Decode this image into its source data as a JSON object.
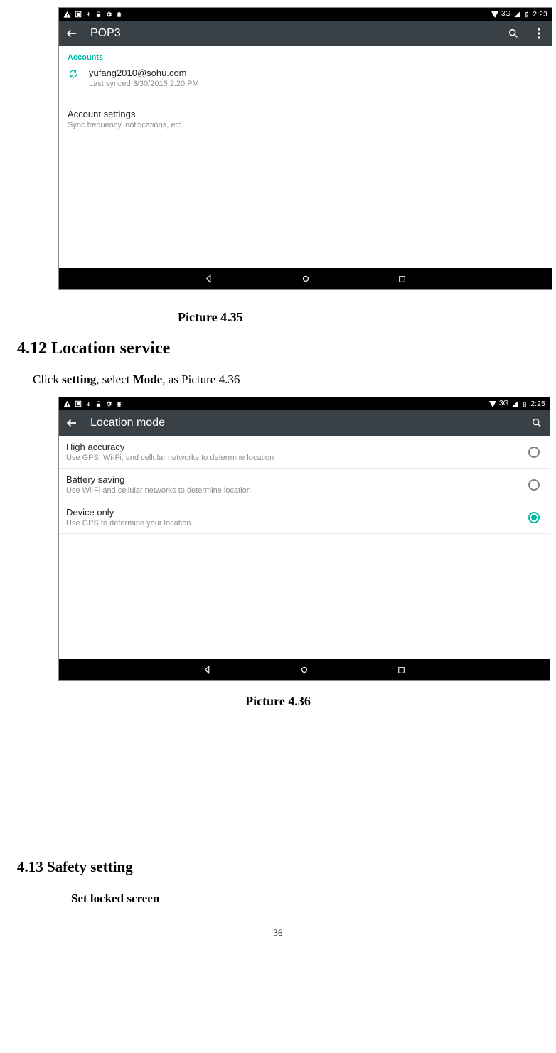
{
  "screenshot1": {
    "statusbar": {
      "signal_text": "3G",
      "time": "2:23"
    },
    "appbar": {
      "title": "POP3"
    },
    "accounts_label": "Accounts",
    "account": {
      "email": "yufang2010@sohu.com",
      "last_sync": "Last synced 3/30/2015 2:20 PM"
    },
    "account_settings": {
      "title": "Account settings",
      "subtitle": "Sync frequency, notifications, etc."
    }
  },
  "caption1": "Picture 4.35",
  "section412_heading": "4.12 Location service",
  "section412_intro_pre": "Click ",
  "section412_intro_b1": "setting",
  "section412_intro_mid": ", select ",
  "section412_intro_b2": "Mode",
  "section412_intro_post": ", as Picture 4.36",
  "screenshot2": {
    "statusbar": {
      "signal_text": "3G",
      "time": "2:25"
    },
    "appbar": {
      "title": "Location mode"
    },
    "modes": [
      {
        "title": "High accuracy",
        "subtitle": "Use GPS, Wi-Fi, and cellular networks to determine location",
        "selected": false
      },
      {
        "title": "Battery saving",
        "subtitle": "Use Wi-Fi and cellular networks to determine location",
        "selected": false
      },
      {
        "title": "Device only",
        "subtitle": "Use GPS to determine your location",
        "selected": true
      }
    ]
  },
  "caption2": "Picture 4.36",
  "section413_heading": "4.13   Safety setting",
  "section413_sub": "Set locked screen",
  "page_number": "36"
}
